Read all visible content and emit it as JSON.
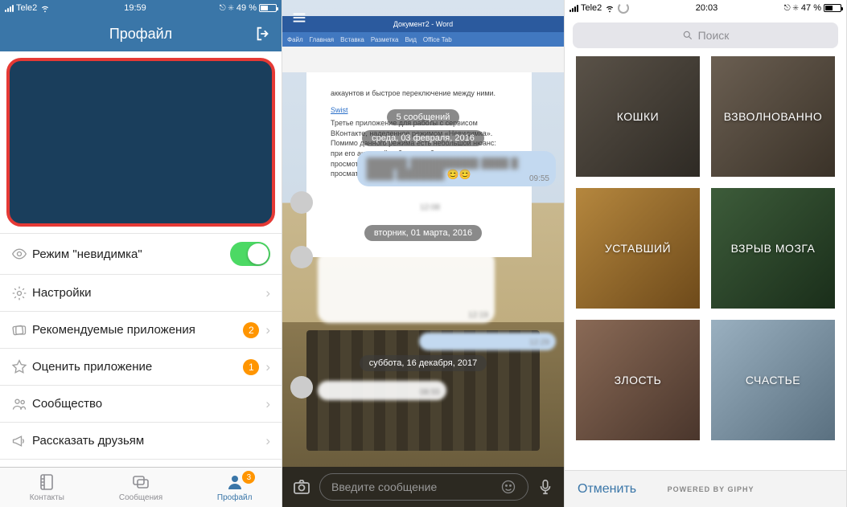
{
  "panel1": {
    "status": {
      "carrier": "Tele2",
      "time": "19:59",
      "battery_pct": "49 %"
    },
    "header": {
      "title": "Профайл"
    },
    "rows": {
      "invisible": {
        "label": "Режим \"невидимка\""
      },
      "settings": {
        "label": "Настройки"
      },
      "recommend": {
        "label": "Рекомендуемые приложения",
        "badge": "2"
      },
      "rate": {
        "label": "Оценить приложение",
        "badge": "1"
      },
      "community": {
        "label": "Сообщество"
      },
      "share": {
        "label": "Рассказать друзьям"
      }
    },
    "tabs": {
      "contacts": {
        "label": "Контакты"
      },
      "messages": {
        "label": "Сообщения"
      },
      "profile": {
        "label": "Профайл",
        "badge": "3"
      }
    }
  },
  "panel2": {
    "word_title": "Документ2 - Word",
    "ribbon": [
      "Файл",
      "Главная",
      "Вставка",
      "Разметка",
      "Вид",
      "Office Tab"
    ],
    "doc_line": "аккаунтов и быстрое переключение между ними.",
    "doc_link": "Swist",
    "doc_body": "Третье приложение для работы с сервисом ВКонтакте, наделенное режимом «Невидимка». Помимо данного режима есть небольшой нюанс: при его активной работе вам будет доступен просмотр ленты новостей от наиболее просматриваемых групп и пользователей.",
    "count_pill": "5 сообщений",
    "date1": "среда, 03 февраля, 2016",
    "date2": "вторник, 01 марта, 2016",
    "date3": "суббота, 16 декабря, 2017",
    "ts1": "09:55",
    "ts2": "12:08",
    "ts3": "12:19",
    "ts4": "12:29",
    "ts5": "08:55",
    "input_placeholder": "Введите сообщение"
  },
  "panel3": {
    "status": {
      "carrier": "Tele2",
      "time": "20:03",
      "battery_pct": "47 %"
    },
    "search_placeholder": "Поиск",
    "tiles": {
      "cats": "КОШКИ",
      "excited": "ВЗВОЛНОВАННО",
      "tired": "УСТАВШИЙ",
      "mindblown": "ВЗРЫВ МОЗГА",
      "anger": "ЗЛОСТЬ",
      "happy": "СЧАСТЬЕ"
    },
    "cancel": "Отменить",
    "giphy": "POWERED BY GIPHY"
  }
}
